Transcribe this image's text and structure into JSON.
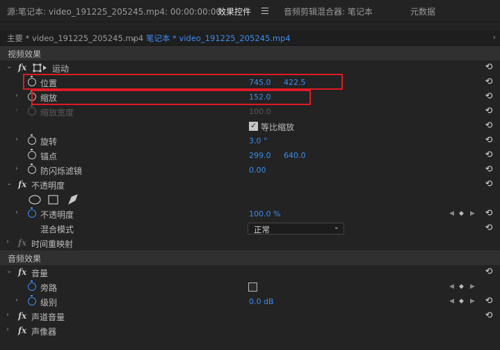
{
  "topbar": {
    "source": "源:笔记本: video_191225_205245.mp4: 00:00:00:00",
    "effect_controls": "效果控件",
    "audio_mixer": "音频剪辑混合器: 笔记本",
    "metadata": "元数据"
  },
  "clip_tabs": {
    "master": "主要 * video_191225_205245.mp4",
    "sequence": "笔记本 * video_191225_205245.mp4"
  },
  "video": {
    "section": "视频效果",
    "motion": "运动",
    "position": {
      "label": "位置",
      "x": "745.0",
      "y": "422.5"
    },
    "scale": {
      "label": "缩放",
      "value": "152.0"
    },
    "scale_width": {
      "label": "缩放宽度",
      "value": "100.0"
    },
    "uniform": "等比缩放",
    "rotation": {
      "label": "旋转",
      "value": "3.0 °"
    },
    "anchor": {
      "label": "锚点",
      "x": "299.0",
      "y": "640.0"
    },
    "flicker": {
      "label": "防闪烁滤镜",
      "value": "0.00"
    },
    "opacity_group": "不透明度",
    "opacity": {
      "label": "不透明度",
      "value": "100.0 %"
    },
    "blend": {
      "label": "混合模式",
      "value": "正常"
    },
    "time_remap": "时间重映射"
  },
  "audio": {
    "section": "音频效果",
    "volume": "音量",
    "bypass": "旁路",
    "level": {
      "label": "级别",
      "value": "0.0 dB"
    },
    "channel_volume": "声道音量",
    "panner": "声像器"
  },
  "colors": {
    "accent": "#3b8ef0",
    "highlight": "#e01b24",
    "panel": "#232323"
  }
}
